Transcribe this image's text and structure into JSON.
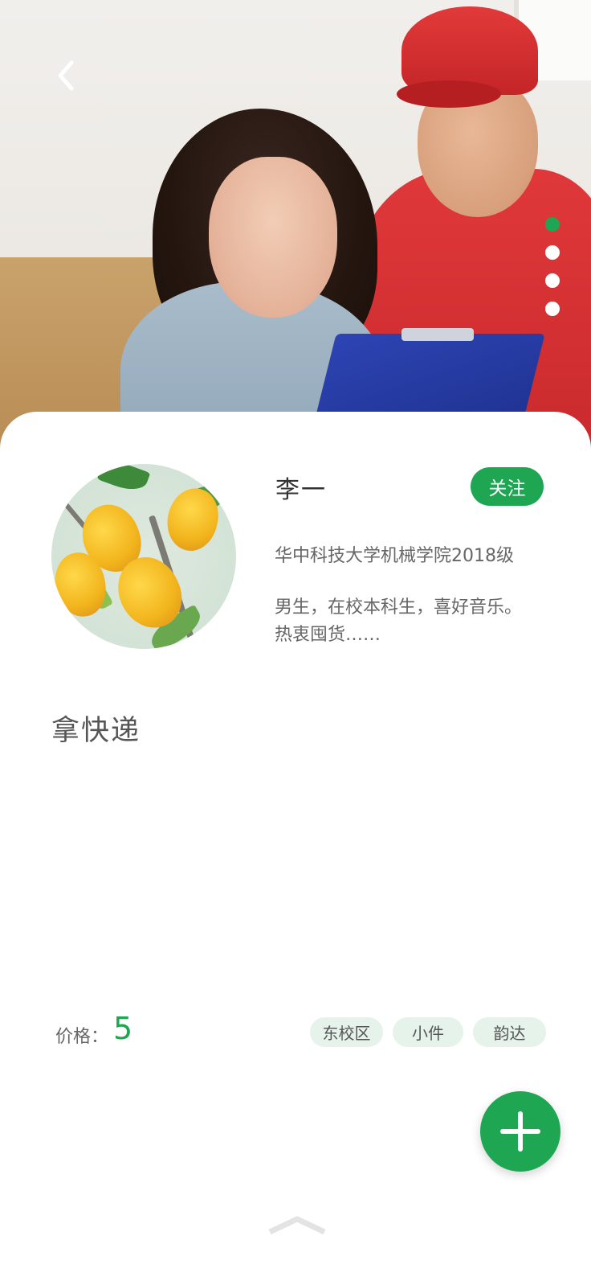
{
  "header": {
    "back_icon": "chevron-left-icon",
    "pager": {
      "total": 4,
      "active_index": 0,
      "active_color": "#1fa653"
    }
  },
  "profile": {
    "name": "李一",
    "follow_label": "关注",
    "school": "华中科技大学机械学院2018级",
    "bio_line1": "男生，在校本科生，喜好音乐。",
    "bio_line2": "热衷囤货……"
  },
  "task": {
    "title": "拿快递",
    "price_label": "价格：",
    "price_value": "5",
    "tags": [
      "东校区",
      "小件",
      "韵达"
    ]
  },
  "actions": {
    "fab_icon": "plus-icon",
    "pull_up_icon": "chevron-up-icon"
  },
  "colors": {
    "accent": "#1fa653",
    "tag_bg": "#e6f3ea"
  }
}
